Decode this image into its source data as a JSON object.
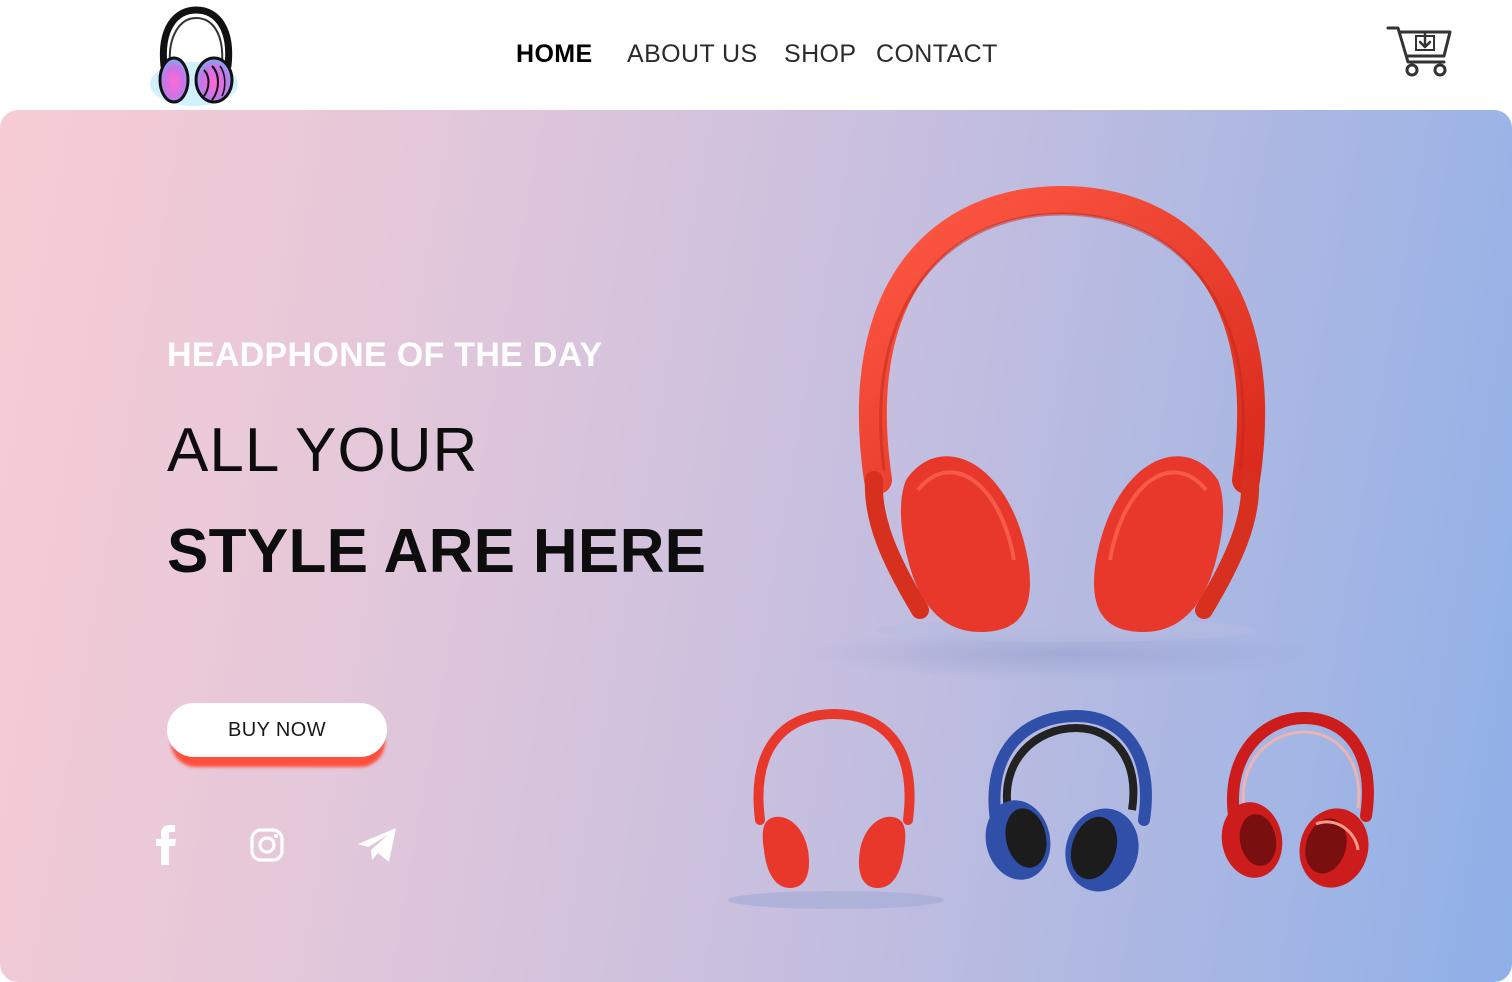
{
  "nav": {
    "items": [
      {
        "label": "HOME",
        "active": true
      },
      {
        "label": "ABOUT US",
        "active": false
      },
      {
        "label": "SHOP",
        "active": false
      },
      {
        "label": "CONTACT",
        "active": false
      }
    ]
  },
  "hero": {
    "tagline": "HEADPHONE OF THE DAY",
    "headline_line1": "ALL YOUR",
    "headline_line2": "STYLE ARE HERE",
    "cta_label": "BUY NOW"
  },
  "social": [
    "facebook-icon",
    "instagram-icon",
    "telegram-icon"
  ],
  "products": {
    "featured": {
      "color": "#e8382c"
    },
    "thumbnails": [
      {
        "color": "#e8382c",
        "icon": "red-headphones"
      },
      {
        "color": "#2f4fa8",
        "icon": "blue-headphones"
      },
      {
        "color": "#cc1c1c",
        "icon": "glossy-red-headphones"
      }
    ]
  },
  "colors": {
    "accent": "#ff4e3c",
    "gradient_start": "#f8ccd4",
    "gradient_end": "#8fb0e8"
  }
}
